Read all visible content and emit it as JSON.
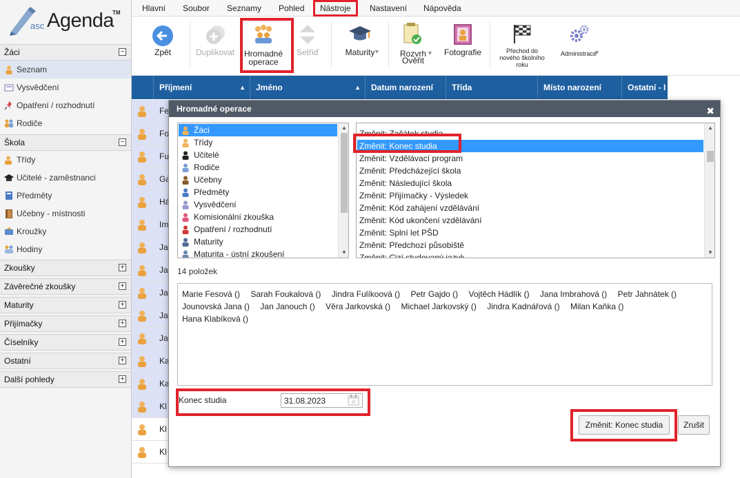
{
  "app": {
    "logo_prefix": "asc",
    "logo_name": "Agenda",
    "logo_tm": "TM"
  },
  "menubar": {
    "items": [
      "Hlavní",
      "Soubor",
      "Seznamy",
      "Pohled",
      "Nástroje",
      "Nastavení",
      "Nápověda"
    ],
    "active": "Nástroje"
  },
  "toolbar": {
    "back": "Zpět",
    "duplicate": "Duplikovat",
    "bulk_line1": "Hromadné",
    "bulk_line2": "operace",
    "sort": "Setřiď",
    "maturity": "Maturity",
    "schedule_line1": "Rozvrh",
    "schedule_line2": "Ověřit",
    "photos": "Fotografie",
    "newyear_line1": "Přechod do",
    "newyear_line2": "nového školního",
    "newyear_line3": "roku",
    "admin": "Administrace"
  },
  "sidebar": {
    "zaci": {
      "title": "Žáci",
      "items": [
        "Seznam",
        "Vysvědčení",
        "Opatření / rozhodnutí",
        "Rodiče"
      ]
    },
    "skola": {
      "title": "Škola",
      "items": [
        "Třídy",
        "Učitelé - zaměstnanci",
        "Předměty",
        "Učebny - místnosti",
        "Kroužky",
        "Hodiny"
      ]
    },
    "collapsed": [
      "Zkoušky",
      "Závěrečné zkoušky",
      "Maturity",
      "Přijímačky",
      "Číselníky",
      "Ostatní",
      "Další pohledy"
    ]
  },
  "grid": {
    "columns": [
      "Příjmení",
      "Jméno",
      "Datum narození",
      "Třída",
      "Místo narození",
      "Ostatní - I"
    ],
    "row_prefixes": [
      "Fe",
      "Fo",
      "Fu",
      "Ga",
      "Há",
      "Im",
      "Ja",
      "Ja",
      "Ja",
      "Ja",
      "Ja",
      "Ka",
      "Ka",
      "Kl",
      "Kl",
      "Kl"
    ]
  },
  "modal": {
    "title": "Hromadné operace",
    "close": "✖",
    "categories": [
      "Žáci",
      "Třídy",
      "Učitelé",
      "Rodiče",
      "Učebny",
      "Předměty",
      "Vysvědčení",
      "Komisionální zkouška",
      "Opatření / rozhodnutí",
      "Maturity",
      "Maturita - ústní zkoušení"
    ],
    "selected_category": "Žáci",
    "operations": [
      "Změnit: Začátek studia",
      "Změnit: Konec studia",
      "Změnit: Vzdělávací program",
      "Změnit: Předcházející škola",
      "Změnit: Následující škola",
      "Změnit: Přijímačky - Výsledek",
      "Změnit: Kód zahájení vzdělávání",
      "Změnit: Kód ukončení vzdělávání",
      "Změnit: Splní let PŠD",
      "Změnit: Předchozí působiště",
      "Změnit: Cizí studovaný jazyk"
    ],
    "selected_operation": "Změnit: Konec studia",
    "count_text": "14 položek",
    "students": [
      "Marie Fesová ()",
      "Sarah Foukalová ()",
      "Jindra Fulíkoová ()",
      "Petr Gajdo ()",
      "Vojtěch Hádlík ()",
      "Jana Imbrahová ()",
      "Petr Jahnátek ()",
      "Jounovská Jana ()",
      "Jan Janouch ()",
      "Věra Jarkovská ()",
      "Michael Jarkovský ()",
      "Jindra Kadnářová ()",
      "Milan Kaňka ()",
      "Hana Klabíková ()"
    ],
    "field_label": "Konec studia",
    "field_value": "31.08.2023",
    "confirm": "Změnit: Konec studia",
    "cancel": "Zrušit"
  },
  "colors": {
    "accent": "#1e5fa0",
    "highlight": "#e0222c",
    "selection": "#3399ff",
    "modal_title": "#4f5a66"
  }
}
